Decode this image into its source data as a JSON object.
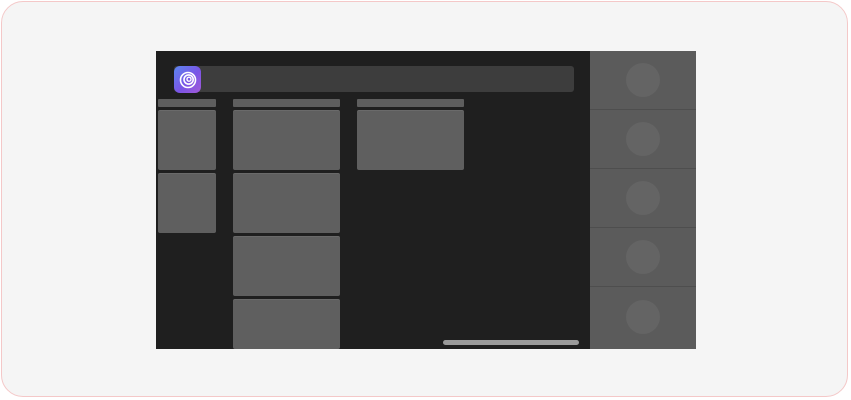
{
  "app": {
    "icon": "app-logo-icon",
    "accent_colors": [
      "#5b86f0",
      "#7a55e6",
      "#a35ad8"
    ]
  },
  "columns": [
    {
      "name": "column-1",
      "cards": 2
    },
    {
      "name": "column-2",
      "cards": 4
    },
    {
      "name": "column-3",
      "cards": 1
    }
  ],
  "rail": {
    "items": [
      "rail-avatar-1",
      "rail-avatar-2",
      "rail-avatar-3",
      "rail-avatar-4",
      "rail-avatar-5"
    ]
  },
  "colors": {
    "background": "#1f1f1f",
    "panel": "#5f5f5f",
    "rail": "#5b5b5b"
  }
}
